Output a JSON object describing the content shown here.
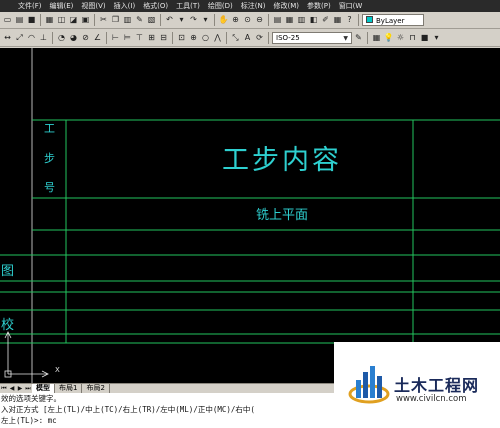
{
  "menubar": {
    "items": [
      "文件(F)",
      "编辑(E)",
      "视图(V)",
      "插入(I)",
      "格式(O)",
      "工具(T)",
      "绘图(D)",
      "标注(N)",
      "修改(M)",
      "参数(P)",
      "窗口(W"
    ]
  },
  "toolbar": {
    "layer_combo": "ByLayer",
    "dimstyle_combo": "ISO-25"
  },
  "drawing": {
    "col_chars": [
      "工",
      "步",
      "号"
    ],
    "title": "工步内容",
    "subtitle": "铣上平面",
    "left_chars": [
      "图",
      "校"
    ],
    "ucs_x": "X",
    "line_color": "#22c55e",
    "text_color": "#2ed0d0"
  },
  "tabs": {
    "items": [
      "模型",
      "布局1",
      "布局2"
    ],
    "active": "模型"
  },
  "command": {
    "lines": [
      "效的选项关键字。",
      "入对正方式 [左上(TL)/中上(TC)/右上(TR)/左中(ML)/正中(MC)/右中(",
      "左上(TL)>: mc"
    ]
  },
  "watermark": {
    "title": "土木工程网",
    "url": "www.civilcn.com"
  }
}
